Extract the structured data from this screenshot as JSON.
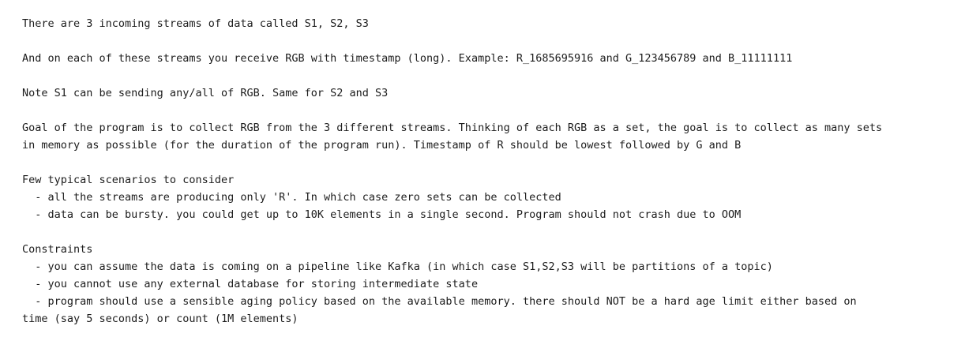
{
  "document": {
    "intro": "There are 3 incoming streams of data called S1, S2, S3",
    "streams_line": "And on each of these streams you receive RGB with timestamp (long). Example: R_1685695916 and G_123456789 and B_11111111",
    "note": "Note S1 can be sending any/all of RGB. Same for S2 and S3",
    "goal_line1": "Goal of the program is to collect RGB from the 3 different streams. Thinking of each RGB as a set, the goal is to collect as many sets",
    "goal_line2": "in memory as possible (for the duration of the program run). Timestamp of R should be lowest followed by G and B",
    "scenarios": {
      "heading": "Few typical scenarios to consider",
      "items": [
        "  - all the streams are producing only 'R'. In which case zero sets can be collected",
        "  - data can be bursty. you could get up to 10K elements in a single second. Program should not crash due to OOM"
      ]
    },
    "constraints": {
      "heading": "Constraints",
      "items": [
        "  - you can assume the data is coming on a pipeline like Kafka (in which case S1,S2,S3 will be partitions of a topic)",
        "  - you cannot use any external database for storing intermediate state",
        "  - program should use a sensible aging policy based on the available memory. there should NOT be a hard age limit either based on"
      ],
      "continuation": "time (say 5 seconds) or count (1M elements)"
    }
  }
}
